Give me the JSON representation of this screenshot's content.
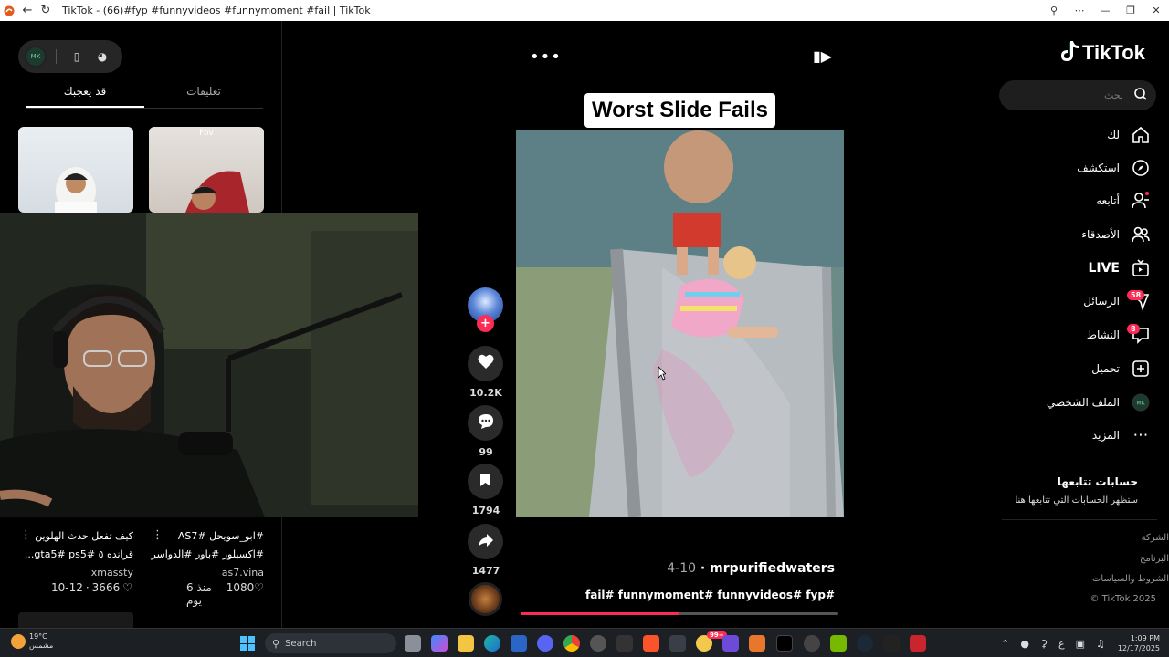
{
  "window": {
    "title": "TikTok - (66)#fyp #funnyvideos #funnymoment #fail | TikTok"
  },
  "left_panel": {
    "tabs": [
      {
        "label": "تعليقات",
        "active": false
      },
      {
        "label": "قد يعجبك",
        "active": true
      }
    ],
    "thumb_overlay_top": "Fov",
    "videos": [
      {
        "caption_line1": "كيف تفعل حدث الهلوين",
        "caption_line2": "قرانده ٥ #gta5# ps5...",
        "author": "xmassty",
        "likes": "3666",
        "date": "10-12"
      },
      {
        "caption_line1": "#ابو_سويحل #AS7",
        "caption_line2": "#اكسبلور #باور #الدواسر",
        "author": "as7.vina",
        "likes": "1080",
        "date": "منذ 6 يوم"
      }
    ]
  },
  "video": {
    "title": "Worst Slide Fails",
    "author": "mrpurifiedwaters",
    "date": "4-10",
    "hashtags": "fail# funnymoment# funnyvideos# fyp#",
    "progress": 0.5
  },
  "actions": {
    "likes": "10.2K",
    "comments": "99",
    "saves": "1794",
    "shares": "1477"
  },
  "sidebar": {
    "logo_text": "TikTok",
    "search_placeholder": "بحث",
    "nav": [
      {
        "label": "لك",
        "icon": "home-icon"
      },
      {
        "label": "استكشف",
        "icon": "compass-icon"
      },
      {
        "label": "أتابعه",
        "icon": "following-icon"
      },
      {
        "label": "الأصدقاء",
        "icon": "friends-icon"
      },
      {
        "label": "LIVE",
        "icon": "live-icon"
      },
      {
        "label": "الرسائل",
        "icon": "messages-icon",
        "badge": "58"
      },
      {
        "label": "النشاط",
        "icon": "activity-icon",
        "badge": "8"
      },
      {
        "label": "تحميل",
        "icon": "upload-icon"
      },
      {
        "label": "الملف الشخصي",
        "icon": "profile-avatar-icon"
      },
      {
        "label": "المزيد",
        "icon": "more-icon"
      }
    ],
    "following_title": "حسابات تتابعها",
    "following_sub": "ستظهر الحسابات التي تتابعها هنا",
    "footer": [
      "الشركة",
      "البرنامج",
      "الشروط والسياسات",
      "© TikTok 2025"
    ]
  },
  "taskbar": {
    "weather_temp": "19°C",
    "weather_desc": "مشمس",
    "search_label": "Search",
    "time": "1:09 PM",
    "date": "12/17/2025",
    "input_lang": "ع",
    "apps_badge": "99+"
  },
  "colors": {
    "accent": "#fe2c55",
    "background": "#000000",
    "taskbar": "#1c1f24"
  }
}
